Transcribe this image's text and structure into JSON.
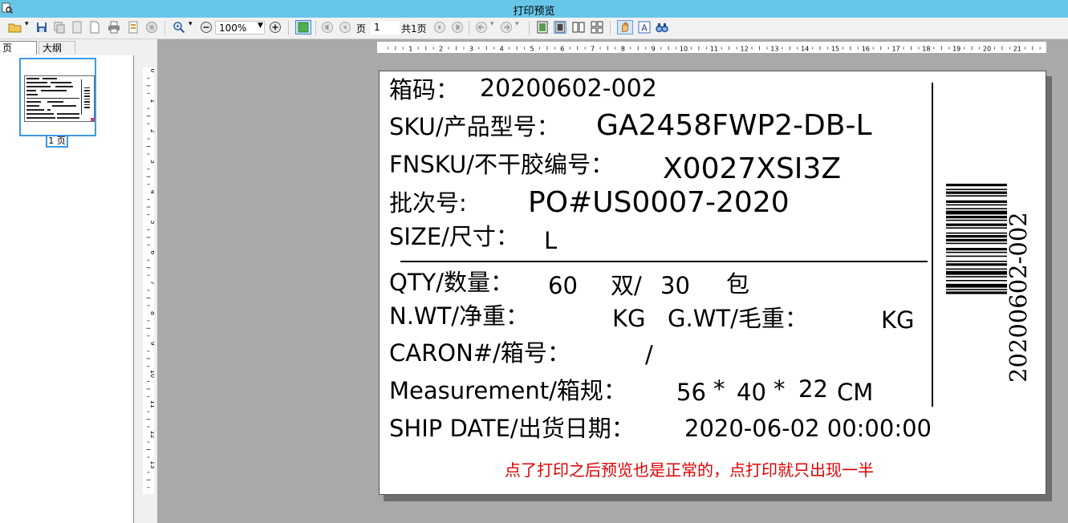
{
  "window": {
    "title": "打印预览"
  },
  "toolbar": {
    "zoom": "100%",
    "page_label": "页",
    "page_value": "1",
    "total_pages": "共1页"
  },
  "tabs": [
    {
      "label": "页"
    },
    {
      "label": "大纲"
    }
  ],
  "thumbnail": {
    "label": "1 页"
  },
  "rulers": {
    "h_ticks": [
      "1",
      "2",
      "3",
      "4",
      "5",
      "6",
      "7",
      "8",
      "9",
      "10",
      "11",
      "12",
      "13",
      "14",
      "15",
      "16",
      "17",
      "18",
      "19",
      "20",
      "21"
    ],
    "v_ticks": [
      "0",
      "1",
      "2",
      "3",
      "4",
      "5",
      "6",
      "7",
      "8",
      "9",
      "10",
      "11",
      "12",
      "13"
    ]
  },
  "label": {
    "box_code_label": "箱码：",
    "box_code_value": "20200602-002",
    "sku_label": "SKU/产品型号：",
    "sku_value": "GA2458FWP2-DB-L",
    "fnsku_label": "FNSKU/不干胶编号：",
    "fnsku_value": "X0027XSI3Z",
    "batch_label": "批次号:",
    "batch_value": "PO#US0007-2020",
    "size_label": "SIZE/尺寸：",
    "size_value": "L",
    "qty_label": "QTY/数量：",
    "qty_pairs": "60",
    "qty_pairs_unit": "双/",
    "qty_packs": "30",
    "qty_packs_unit": "包",
    "nwt_label": "N.WT/净重：",
    "nwt_unit": "KG",
    "gwt_label": "G.WT/毛重：",
    "gwt_unit": "KG",
    "carton_label": "CARON#/箱号：",
    "carton_value": "/",
    "measurement_label": "Measurement/箱规：",
    "measurement_l": "56",
    "measurement_w": "40",
    "measurement_h": "22",
    "measurement_times": "*",
    "measurement_unit": "CM",
    "ship_label": "SHIP DATE/出货日期：",
    "ship_value": "2020-06-02 00:00:00",
    "barcode_text": "20200602-002",
    "note": "点了打印之后预览也是正常的，点打印就只出现一半"
  }
}
